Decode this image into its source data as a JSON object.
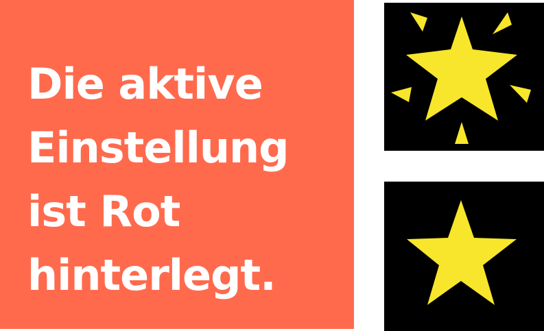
{
  "info": {
    "lines": [
      "Die aktive",
      "Einstellung",
      "ist Rot",
      "hinterlegt."
    ],
    "background_color": "#ff6a4d",
    "text_color": "#ffffff"
  },
  "tiles": [
    {
      "icon": "sparkling-star-icon",
      "state": "active",
      "star_color": "#f7e62b"
    },
    {
      "icon": "star-icon",
      "state": "inactive",
      "star_color": "#f7e62b"
    }
  ]
}
